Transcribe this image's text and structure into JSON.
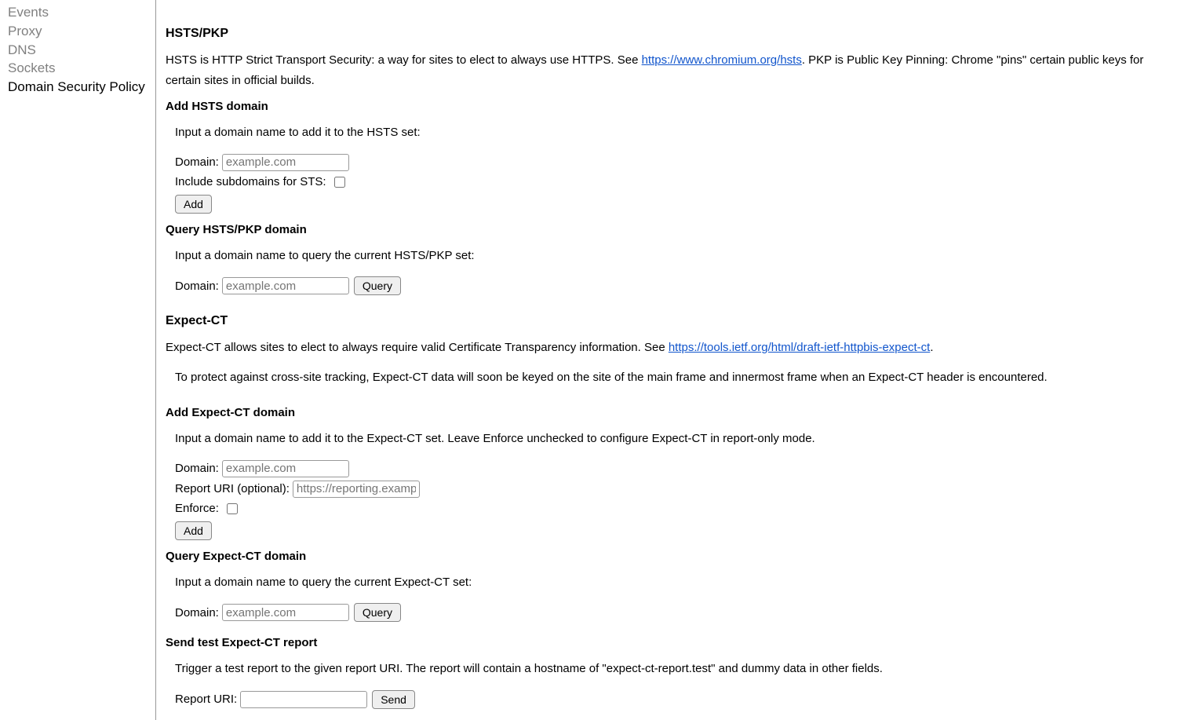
{
  "sidebar": {
    "items": [
      {
        "label": "Events",
        "active": false
      },
      {
        "label": "Proxy",
        "active": false
      },
      {
        "label": "DNS",
        "active": false
      },
      {
        "label": "Sockets",
        "active": false
      },
      {
        "label": "Domain Security Policy",
        "active": true
      }
    ]
  },
  "hsts": {
    "heading": "HSTS/PKP",
    "intro_prefix": "HSTS is HTTP Strict Transport Security: a way for sites to elect to always use HTTPS. See ",
    "intro_link": "https://www.chromium.org/hsts",
    "intro_suffix": ". PKP is Public Key Pinning: Chrome \"pins\" certain public keys for certain sites in official builds.",
    "add_heading": "Add HSTS domain",
    "add_help": "Input a domain name to add it to the HSTS set:",
    "domain_label": "Domain:",
    "domain_placeholder": "example.com",
    "include_subdomains_label": "Include subdomains for STS:",
    "add_button": "Add",
    "query_heading": "Query HSTS/PKP domain",
    "query_help": "Input a domain name to query the current HSTS/PKP set:",
    "query_button": "Query"
  },
  "expect_ct": {
    "heading": "Expect-CT",
    "intro_prefix": "Expect-CT allows sites to elect to always require valid Certificate Transparency information. See ",
    "intro_link": "https://tools.ietf.org/html/draft-ietf-httpbis-expect-ct",
    "intro_suffix": ".",
    "note": "To protect against cross-site tracking, Expect-CT data will soon be keyed on the site of the main frame and innermost frame when an Expect-CT header is encountered.",
    "add_heading": "Add Expect-CT domain",
    "add_help": "Input a domain name to add it to the Expect-CT set. Leave Enforce unchecked to configure Expect-CT in report-only mode.",
    "domain_label": "Domain:",
    "domain_placeholder": "example.com",
    "report_uri_label": "Report URI (optional):",
    "report_uri_placeholder": "https://reporting.example",
    "enforce_label": "Enforce:",
    "add_button": "Add",
    "query_heading": "Query Expect-CT domain",
    "query_help": "Input a domain name to query the current Expect-CT set:",
    "query_button": "Query",
    "send_heading": "Send test Expect-CT report",
    "send_help": "Trigger a test report to the given report URI. The report will contain a hostname of \"expect-ct-report.test\" and dummy data in other fields.",
    "send_report_uri_label": "Report URI:",
    "send_button": "Send"
  }
}
